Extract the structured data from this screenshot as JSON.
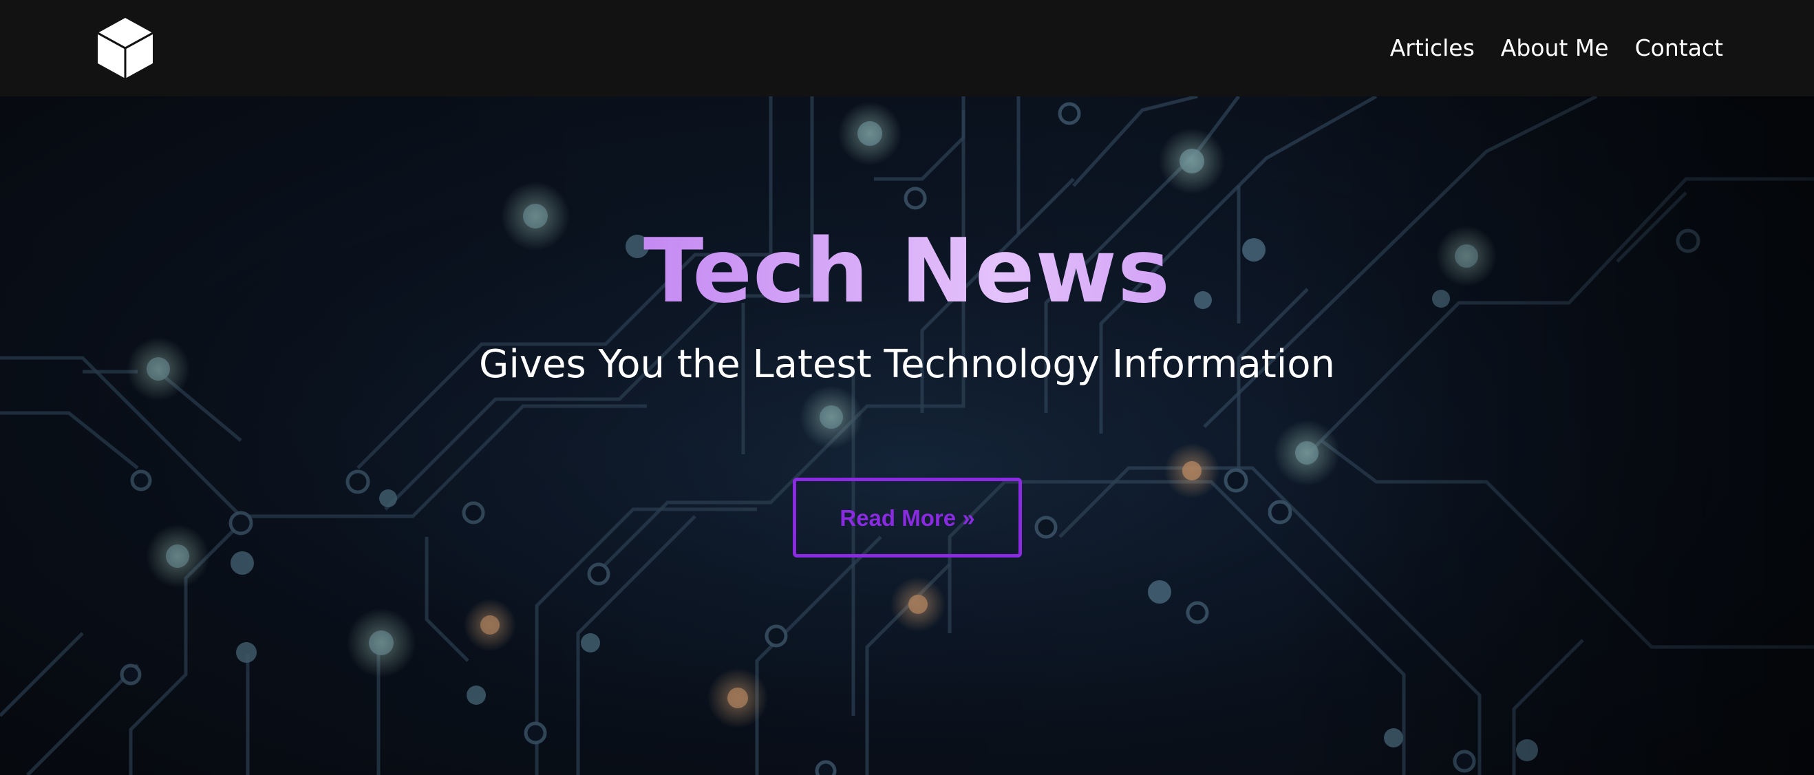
{
  "header": {
    "logo_icon": "cube-icon",
    "nav": [
      {
        "label": "Articles"
      },
      {
        "label": "About Me"
      },
      {
        "label": "Contact"
      }
    ]
  },
  "hero": {
    "title": "Tech News",
    "subtitle": "Gives You the Latest Technology Information",
    "cta_label": "Read More »",
    "background": "circuit-board-image"
  },
  "colors": {
    "nav_bg": "#121212",
    "accent": "#8a2be2",
    "title_gradient_start": "#8a3fe3",
    "title_gradient_mid": "#e4c2fb",
    "hero_bg": "#0b1422"
  }
}
